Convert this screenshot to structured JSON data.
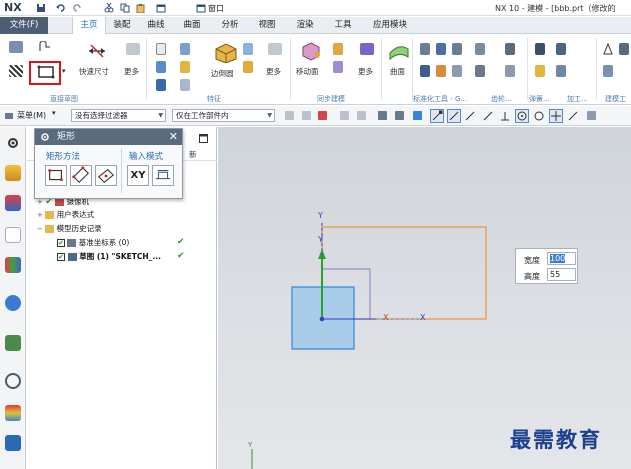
{
  "titlebar": {
    "logo": "NX",
    "title": "NX 10 - 建模 - [bbb.prt（修改的",
    "window_menu": "窗口",
    "icons": [
      "save-icon",
      "undo-icon",
      "redo-icon",
      "cut-icon",
      "copy-icon",
      "paste-icon",
      "window-icon"
    ]
  },
  "tabs": [
    {
      "label": "文件(F)",
      "type": "file"
    },
    {
      "label": "主页",
      "type": "active"
    },
    {
      "label": "装配"
    },
    {
      "label": "曲线"
    },
    {
      "label": "曲面"
    },
    {
      "label": "分析"
    },
    {
      "label": "视图"
    },
    {
      "label": "渲染"
    },
    {
      "label": "工具"
    },
    {
      "label": "应用模块"
    }
  ],
  "ribbon": {
    "labels": {
      "quick_dimension": "快速尺寸",
      "more_1": "更多",
      "edge_blend": "边倒圆",
      "more_2": "更多",
      "move_face": "移动面",
      "more_3": "更多",
      "surface": "曲面"
    },
    "groups": {
      "sketch": "直接草图",
      "feature": "特征",
      "sync": "同步建模",
      "std_tools": "标准化工具 - G...",
      "gear": "齿轮...",
      "spring": "弹簧...",
      "machining": "加工...",
      "modeling": "建模工"
    }
  },
  "filterbar": {
    "menu": "菜单(M)",
    "filter": "没有选择过滤器",
    "scope": "仅在工作部件内"
  },
  "navigator": {
    "header_new": "新",
    "tree": [
      {
        "label": "摄像机",
        "checked": false
      },
      {
        "label": "用户表达式",
        "checked": false
      },
      {
        "label": "模型历史记录",
        "checked": false
      },
      {
        "label": "基准坐标系 (0)",
        "checked": true
      },
      {
        "label": "草图 (1) \"SKETCH_...",
        "checked": true
      }
    ]
  },
  "dialog": {
    "title": "矩形",
    "method_label": "矩形方法",
    "input_mode_label": "输入模式",
    "xy_label": "XY"
  },
  "dimension": {
    "width_label": "宽度",
    "width_value": "100",
    "height_label": "高度",
    "height_value": "55"
  },
  "canvas": {
    "axis_x": "X",
    "axis_y": "Y"
  },
  "watermark": "最需教育",
  "colors": {
    "file_tab": "#4d5d72",
    "active_tab_text": "#2a6ab5",
    "highlight": "#d7141a",
    "rect_preview": "#e8953a",
    "square_fill": "#a9cce8",
    "square_stroke": "#3a8de0",
    "axis_green": "#2aa12a",
    "axis_blue": "#3c3cc8"
  }
}
